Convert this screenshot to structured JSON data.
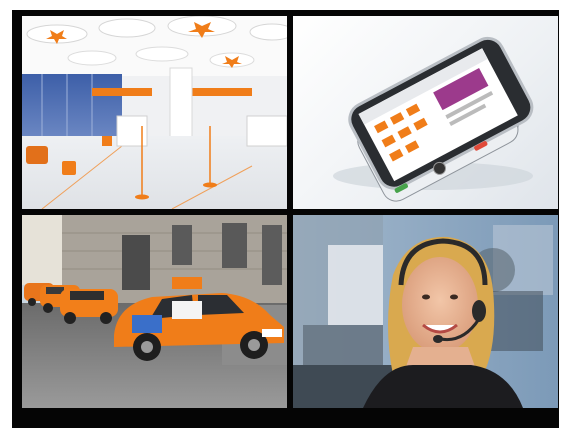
{
  "tiles": [
    {
      "name": "office-interior"
    },
    {
      "name": "smartphone"
    },
    {
      "name": "orange-taxis"
    },
    {
      "name": "call-center-agent"
    }
  ],
  "colors": {
    "accent": "#f07d19",
    "frame": "#050505"
  }
}
